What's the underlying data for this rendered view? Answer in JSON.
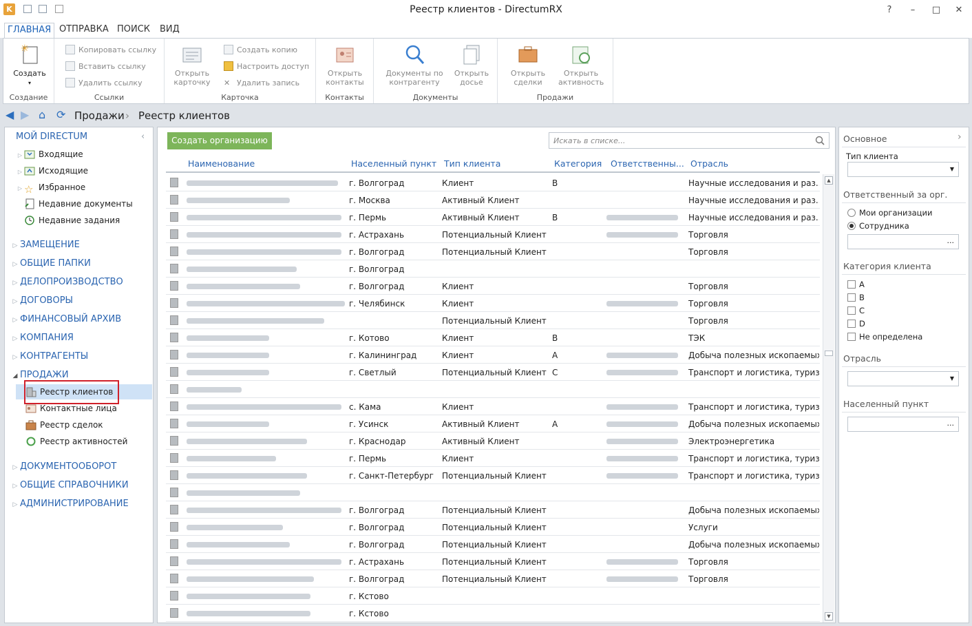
{
  "window": {
    "title": "Реестр клиентов - DirectumRX",
    "controls": [
      "?",
      "–",
      "□",
      "✕"
    ]
  },
  "ribbon_tabs": [
    "ГЛАВНАЯ",
    "ОТПРАВКА",
    "ПОИСК",
    "ВИД"
  ],
  "ribbon": {
    "create": {
      "label": "Создать",
      "group": "Создание"
    },
    "links": {
      "items": [
        "Копировать ссылку",
        "Вставить ссылку",
        "Удалить ссылку"
      ],
      "group": "Ссылки"
    },
    "card": {
      "open_card": "Открыть карточку",
      "items": [
        "Создать копию",
        "Настроить доступ",
        "Удалить запись"
      ],
      "group": "Карточка"
    },
    "contacts": {
      "open_contacts": "Открыть контакты",
      "group": "Контакты"
    },
    "documents": {
      "docs_by_counterparty": "Документы по контрагенту",
      "open_dossier": "Открыть досье",
      "group": "Документы"
    },
    "sales": {
      "open_deals": "Открыть сделки",
      "open_activity": "Открыть активность",
      "group": "Продажи"
    }
  },
  "breadcrumb": [
    "Продажи",
    "Реестр клиентов"
  ],
  "nav": {
    "my_directum": "МОЙ DIRECTUM",
    "my_items": [
      "Входящие",
      "Исходящие",
      "Избранное",
      "Недавние документы",
      "Недавние задания"
    ],
    "sections_top": [
      "ЗАМЕЩЕНИЕ",
      "ОБЩИЕ ПАПКИ",
      "ДЕЛОПРОИЗВОДСТВО",
      "ДОГОВОРЫ",
      "ФИНАНСОВЫЙ АРХИВ",
      "КОМПАНИЯ",
      "КОНТРАГЕНТЫ"
    ],
    "sales": "ПРОДАЖИ",
    "sales_items": [
      "Реестр клиентов",
      "Контактные лица",
      "Реестр сделок",
      "Реестр активностей"
    ],
    "sections_bottom": [
      "ДОКУМЕНТООБОРОТ",
      "ОБЩИЕ СПРАВОЧНИКИ",
      "АДМИНИСТРИРОВАНИЕ"
    ]
  },
  "list": {
    "create_button": "Создать организацию",
    "search_placeholder": "Искать в списке...",
    "columns": [
      "Наименование",
      "Населенный пункт",
      "Тип клиента",
      "Категория",
      "Ответственны...",
      "Отрасль"
    ],
    "rows": [
      {
        "city": "г. Волгоград",
        "type": "Клиент",
        "category": "В",
        "resp": false,
        "industry": "Научные исследования и раз..."
      },
      {
        "city": "г. Москва",
        "type": "Активный Клиент",
        "category": "",
        "resp": false,
        "industry": "Научные исследования и раз..."
      },
      {
        "city": "г. Пермь",
        "type": "Активный Клиент",
        "category": "В",
        "resp": true,
        "industry": "Научные исследования и раз..."
      },
      {
        "city": "г. Астрахань",
        "type": "Потенциальный Клиент",
        "category": "",
        "resp": true,
        "industry": "Торговля"
      },
      {
        "city": "г. Волгоград",
        "type": "Потенциальный Клиент",
        "category": "",
        "resp": false,
        "industry": "Торговля"
      },
      {
        "city": "г. Волгоград",
        "type": "",
        "category": "",
        "resp": false,
        "industry": ""
      },
      {
        "city": "г. Волгоград",
        "type": "Клиент",
        "category": "",
        "resp": false,
        "industry": "Торговля"
      },
      {
        "city": "г. Челябинск",
        "type": "Клиент",
        "category": "",
        "resp": true,
        "industry": "Торговля"
      },
      {
        "city": "",
        "type": "Потенциальный Клиент",
        "category": "",
        "resp": false,
        "industry": "Торговля"
      },
      {
        "city": "г. Котово",
        "type": "Клиент",
        "category": "В",
        "resp": false,
        "industry": "ТЭК"
      },
      {
        "city": "г. Калининград",
        "type": "Клиент",
        "category": "А",
        "resp": true,
        "industry": "Добыча полезных ископаемых"
      },
      {
        "city": "г. Светлый",
        "type": "Потенциальный Клиент",
        "category": "С",
        "resp": true,
        "industry": "Транспорт и логистика, туризм"
      },
      {
        "city": "",
        "type": "",
        "category": "",
        "resp": false,
        "industry": ""
      },
      {
        "city": "с. Кама",
        "type": "Клиент",
        "category": "",
        "resp": true,
        "industry": "Транспорт и логистика, туризм"
      },
      {
        "city": "г. Усинск",
        "type": "Активный Клиент",
        "category": "А",
        "resp": true,
        "industry": "Добыча полезных ископаемых"
      },
      {
        "city": "г. Краснодар",
        "type": "Активный Клиент",
        "category": "",
        "resp": true,
        "industry": "Электроэнергетика"
      },
      {
        "city": "г. Пермь",
        "type": "Клиент",
        "category": "",
        "resp": true,
        "industry": "Транспорт и логистика, туризм"
      },
      {
        "city": "г. Санкт-Петербург",
        "type": "Потенциальный Клиент",
        "category": "",
        "resp": true,
        "industry": "Транспорт и логистика, туризм"
      },
      {
        "city": "",
        "type": "",
        "category": "",
        "resp": false,
        "industry": ""
      },
      {
        "city": "г. Волгоград",
        "type": "Потенциальный Клиент",
        "category": "",
        "resp": false,
        "industry": "Добыча полезных ископаемых"
      },
      {
        "city": "г. Волгоград",
        "type": "Потенциальный Клиент",
        "category": "",
        "resp": false,
        "industry": "Услуги"
      },
      {
        "city": "г. Волгоград",
        "type": "Потенциальный Клиент",
        "category": "",
        "resp": false,
        "industry": "Добыча полезных ископаемых"
      },
      {
        "city": "г. Астрахань",
        "type": "Потенциальный Клиент",
        "category": "",
        "resp": true,
        "industry": "Торговля"
      },
      {
        "city": "г. Волгоград",
        "type": "Потенциальный Клиент",
        "category": "",
        "resp": true,
        "industry": "Торговля"
      },
      {
        "city": "г. Кстово",
        "type": "",
        "category": "",
        "resp": false,
        "industry": ""
      },
      {
        "city": "г. Кстово",
        "type": "",
        "category": "",
        "resp": false,
        "industry": ""
      }
    ]
  },
  "filter": {
    "title": "Основное",
    "client_type_label": "Тип клиента",
    "responsible_title": "Ответственный за орг.",
    "radio_options": [
      "Мои организации",
      "Сотрудника"
    ],
    "category_title": "Категория клиента",
    "categories": [
      "А",
      "В",
      "С",
      "D",
      "Не определена"
    ],
    "industry_title": "Отрасль",
    "city_title": "Населенный пункт"
  }
}
